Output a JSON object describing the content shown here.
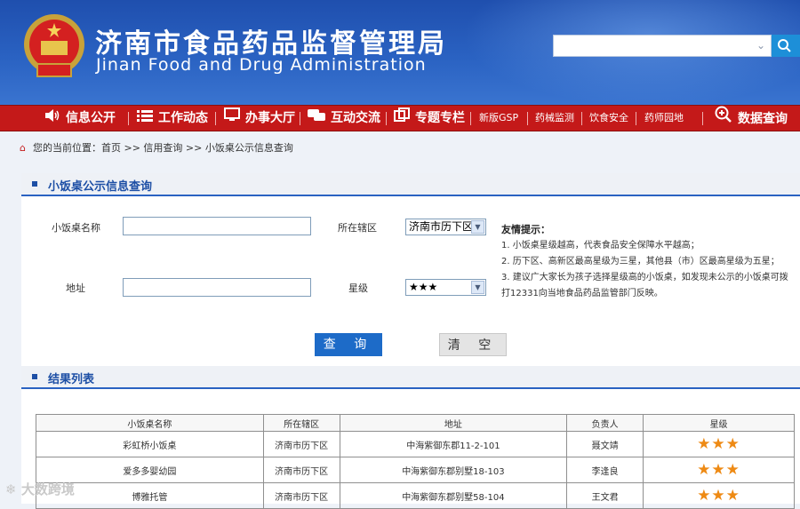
{
  "header": {
    "title_cn": "济南市食品药品监督管理局",
    "title_en": "Jinan Food and Drug Administration",
    "search": {
      "placeholder": "",
      "dropdown_icon": "chevron-down-icon",
      "button_icon": "search-icon"
    }
  },
  "nav": {
    "items": [
      {
        "label": "信息公开",
        "icon": "speaker-icon"
      },
      {
        "label": "工作动态",
        "icon": "list-icon"
      },
      {
        "label": "办事大厅",
        "icon": "monitor-icon"
      },
      {
        "label": "互动交流",
        "icon": "chat-icon"
      },
      {
        "label": "专题专栏",
        "icon": "windows-icon"
      }
    ],
    "links": [
      "新版GSP",
      "药械监测",
      "饮食安全",
      "药师园地"
    ],
    "data_query": "数据查询"
  },
  "breadcrumb": {
    "text": "您的当前位置：首页 >> 信用查询 >> 小饭桌公示信息查询"
  },
  "query_panel": {
    "title": "小饭桌公示信息查询",
    "name_label": "小饭桌名称",
    "district_label": "所在辖区",
    "district_value": "济南市历下区",
    "address_label": "地址",
    "star_label": "星级",
    "star_value": "★★★",
    "tips": {
      "title": "友情提示：",
      "lines": [
        "1. 小饭桌星级越高，代表食品安全保障水平越高；",
        "2. 历下区、高新区最高星级为三星，其他县（市）区最高星级为五星；",
        "3. 建议广大家长为孩子选择星级高的小饭桌，如发现未公示的小饭桌可拨打12331向当地食品药品监管部门反映。"
      ]
    },
    "query_button": "查 询",
    "clear_button": "清 空"
  },
  "results": {
    "title": "结果列表",
    "columns": [
      "小饭桌名称",
      "所在辖区",
      "地址",
      "负责人",
      "星级"
    ],
    "rows": [
      {
        "name": "彩虹桥小饭桌",
        "district": "济南市历下区",
        "address": "中海紫御东郡11-2-101",
        "owner": "聂文靖",
        "stars": 3
      },
      {
        "name": "爱多多婴幼园",
        "district": "济南市历下区",
        "address": "中海紫御东郡别墅18-103",
        "owner": "李逢良",
        "stars": 3
      },
      {
        "name": "博雅托管",
        "district": "济南市历下区",
        "address": "中海紫御东郡别墅58-104",
        "owner": "王文君",
        "stars": 3
      }
    ]
  },
  "watermark": "大数跨境",
  "colors": {
    "header_blue": "#2a62c2",
    "nav_red": "#c41919",
    "star_orange": "#ee8a14",
    "button_blue": "#1d6bc8"
  }
}
